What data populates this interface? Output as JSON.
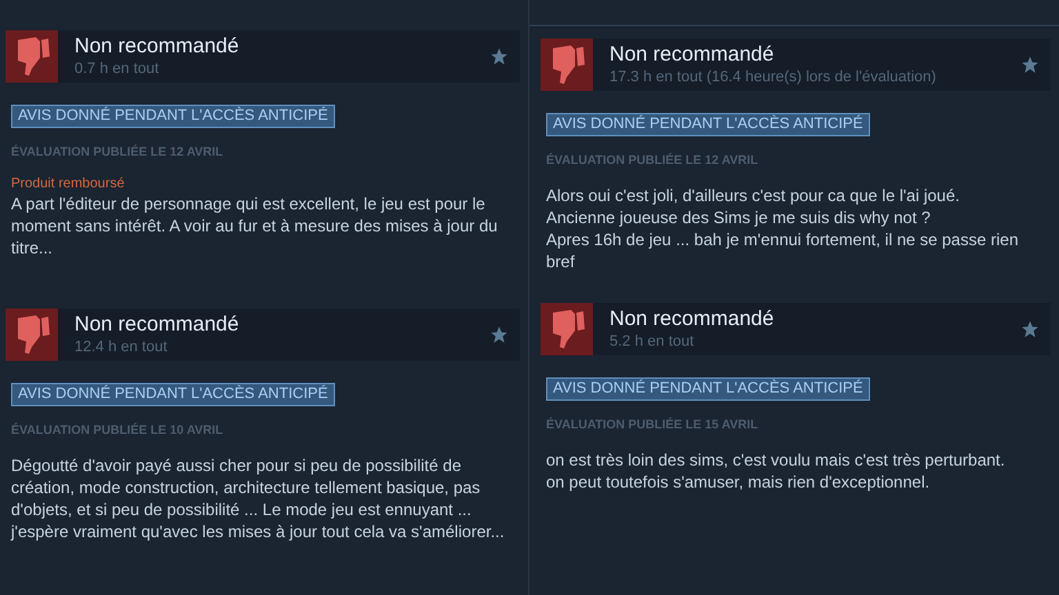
{
  "columns": [
    {
      "reviews": [
        {
          "title": "Non recommandé",
          "hours": "0.7 h en tout",
          "badge": "AVIS DONNÉ PENDANT L'ACCÈS ANTICIPÉ",
          "date": "ÉVALUATION PUBLIÉE LE 12 AVRIL",
          "refund": "Produit remboursé",
          "body": [
            "A part l'éditeur de personnage qui est excellent, le jeu est pour le moment sans intérêt. A voir au fur et à mesure des mises à jour du titre..."
          ]
        },
        {
          "title": "Non recommandé",
          "hours": "12.4 h en tout",
          "badge": "AVIS DONNÉ PENDANT L'ACCÈS ANTICIPÉ",
          "date": "ÉVALUATION PUBLIÉE LE 10 AVRIL",
          "body": [
            "Dégoutté d'avoir payé aussi cher pour si peu de possibilité de création, mode construction, architecture tellement basique, pas d'objets, et si peu de possibilité ... Le mode jeu est ennuyant ... j'espère vraiment qu'avec les mises à jour tout cela va s'améliorer..."
          ]
        }
      ]
    },
    {
      "reviews": [
        {
          "title": "Non recommandé",
          "hours": "17.3 h en tout (16.4 heure(s) lors de l'évaluation)",
          "badge": "AVIS DONNÉ PENDANT L'ACCÈS ANTICIPÉ",
          "date": "ÉVALUATION PUBLIÉE LE 12 AVRIL",
          "body": [
            "Alors oui c'est joli, d'ailleurs c'est pour ca que le l'ai joué.",
            "Ancienne joueuse des Sims je me suis dis why not ?",
            "Apres 16h de jeu ... bah je m'ennui fortement, il ne se passe rien bref"
          ]
        },
        {
          "title": "Non recommandé",
          "hours": "5.2 h en tout",
          "badge": "AVIS DONNÉ PENDANT L'ACCÈS ANTICIPÉ",
          "date": "ÉVALUATION PUBLIÉE LE 15 AVRIL",
          "body": [
            "on est très loin des sims, c'est voulu mais c'est très perturbant.",
            "on peut toutefois s'amuser, mais rien d'exceptionnel."
          ]
        }
      ]
    }
  ]
}
